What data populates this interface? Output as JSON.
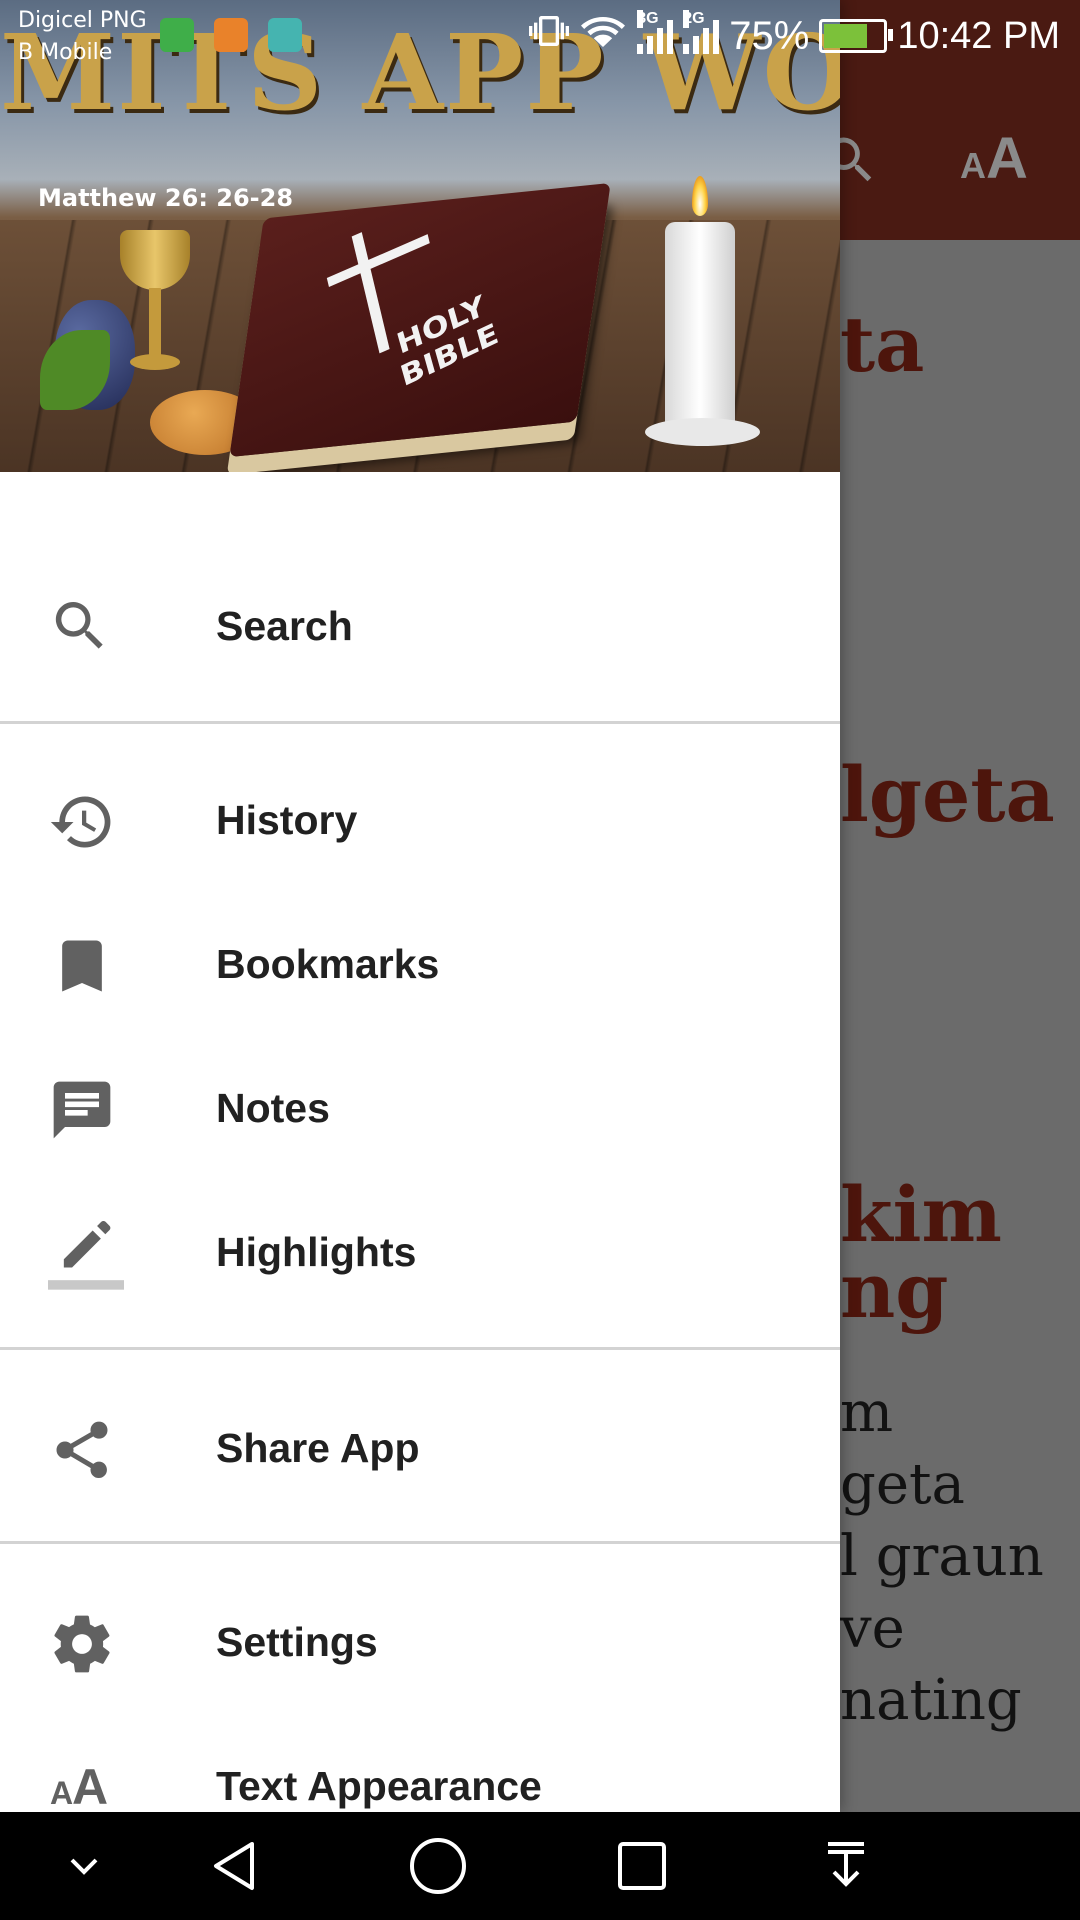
{
  "status_bar": {
    "carrier_line1": "Digicel PNG",
    "carrier_line2": "B Mobile",
    "network_1": "3G",
    "network_2": "2G",
    "battery_percent": "75%",
    "time": "10:42 PM",
    "battery_level": 0.75
  },
  "header": {
    "brand": "MITS APP WORLD",
    "verse_reference": "Matthew 26: 26-28",
    "book_title_line1": "HOLY",
    "book_title_line2": "BIBLE"
  },
  "menu": {
    "search": "Search",
    "history": "History",
    "bookmarks": "Bookmarks",
    "notes": "Notes",
    "highlights": "Highlights",
    "share_app": "Share App",
    "settings": "Settings",
    "text_appearance": "Text Appearance"
  },
  "background_content": {
    "heading_1": "ta",
    "heading_2": "lgeta",
    "heading_3a": "kim",
    "heading_3b": "ng",
    "body_1": "m",
    "body_2": "geta",
    "body_3": "l graun",
    "body_4": "ve",
    "body_5": "nating"
  },
  "colors": {
    "toolbar": "#4a1a12",
    "drawer_bg": "#ffffff",
    "menu_text": "#212121",
    "icon_gray": "#616161",
    "brand_gold": "#c9a24a"
  }
}
